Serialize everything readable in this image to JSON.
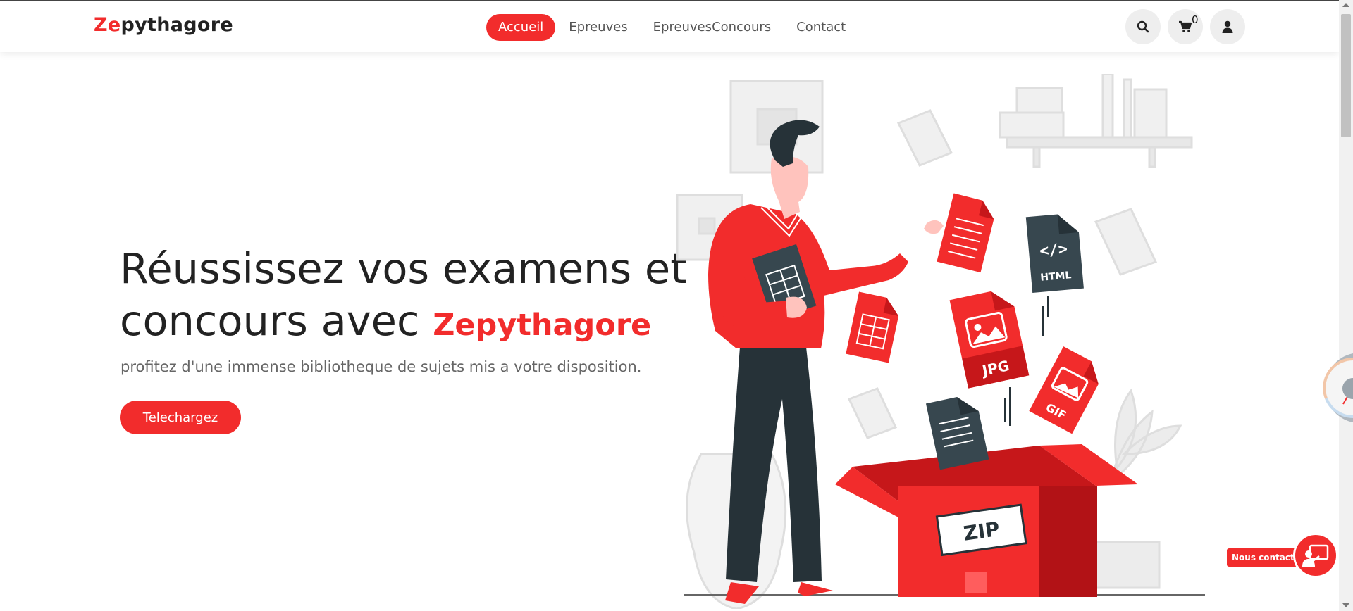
{
  "header": {
    "brand_accent": "Ze",
    "brand_rest": "pythagore",
    "nav": [
      {
        "label": "Accueil",
        "active": true
      },
      {
        "label": "Epreuves",
        "active": false
      },
      {
        "label": "EpreuvesConcours",
        "active": false
      },
      {
        "label": "Contact",
        "active": false
      }
    ],
    "icons": {
      "search": "search-icon",
      "cart": "cart-icon",
      "user": "user-icon"
    },
    "cart_count": "0"
  },
  "hero": {
    "title_line1": "Réussissez vos examens et",
    "title_line2": "concours avec",
    "title_brand": "Zepythagore",
    "subtitle": "profitez d'une immense bibliotheque de sujets mis a votre disposition.",
    "cta_label": "Telechargez"
  },
  "illustration": {
    "labels": {
      "html": "HTML",
      "jpg": "JPG",
      "gif": "GIF",
      "zip": "ZIP"
    }
  },
  "widgets": {
    "gauge_value": "00",
    "contact_label": "Nous contacter ?"
  },
  "colors": {
    "accent": "#f22c2c",
    "dark": "#263238"
  }
}
